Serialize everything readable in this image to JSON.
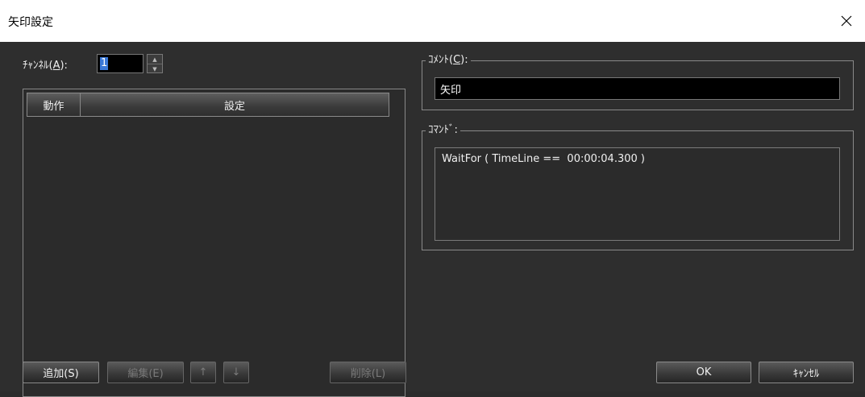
{
  "window": {
    "title": "矢印設定",
    "close_icon": "×"
  },
  "channel": {
    "label": "ﾁｬﾝﾈﾙ(",
    "mnemonic": "A",
    "label_suffix": "):",
    "value": "1",
    "spin_up": "▲",
    "spin_down": "▼"
  },
  "list": {
    "columns": [
      "動作",
      "設定"
    ]
  },
  "buttons": {
    "add": "追加(S)",
    "edit": "編集(E)",
    "up": "↑",
    "down": "↓",
    "delete": "削除(L)",
    "ok": "OK",
    "cancel": "ｷｬﾝｾﾙ"
  },
  "comment": {
    "label": "ｺﾒﾝﾄ(",
    "mnemonic": "C",
    "label_suffix": "):",
    "value": "矢印"
  },
  "command": {
    "label": "ｺﾏﾝﾄﾞ:",
    "value": "WaitFor ( TimeLine ==  00:00:04.300 )"
  }
}
